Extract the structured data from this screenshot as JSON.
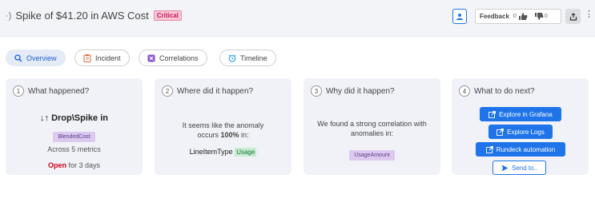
{
  "header": {
    "title": "Spike of $41.20 in AWS Cost",
    "severity": "Critical",
    "feedback": {
      "label": "Feedback",
      "up_count": "0",
      "down_count": "0"
    }
  },
  "tabs": [
    {
      "label": "Overview",
      "icon": "search-icon",
      "active": true
    },
    {
      "label": "Incident",
      "icon": "clipboard-icon",
      "active": false
    },
    {
      "label": "Correlations",
      "icon": "graph-icon",
      "active": false
    },
    {
      "label": "Timeline",
      "icon": "clock-icon",
      "active": false
    }
  ],
  "cards": {
    "what": {
      "num": "1",
      "title": "What happened?",
      "headline": "↓↑ Drop\\Spike in",
      "metric": "BlendedCost",
      "across": "Across 5 metrics",
      "status": "Open",
      "status_suffix": "for 3 days"
    },
    "where": {
      "num": "2",
      "title": "Where did it happen?",
      "line1": "It seems like the anomaly",
      "line2_prefix": "occurs",
      "line2_pct": "100%",
      "line2_suffix": "in:",
      "dim_key": "LineItemType",
      "dim_val": "Usage"
    },
    "why": {
      "num": "3",
      "title": "Why did it happen?",
      "line1": "We found a strong correlation with",
      "line2": "anomalies in:",
      "metric": "UsageAmount"
    },
    "next": {
      "num": "4",
      "title": "What to do next?",
      "actions": [
        "Explore in Grafana",
        "Explore Logs",
        "Rundeck automation"
      ],
      "send": "Send to.."
    }
  },
  "colors": {
    "accent": "#1e74e8",
    "critical": "#c2185b",
    "open_status": "#d0021b"
  }
}
